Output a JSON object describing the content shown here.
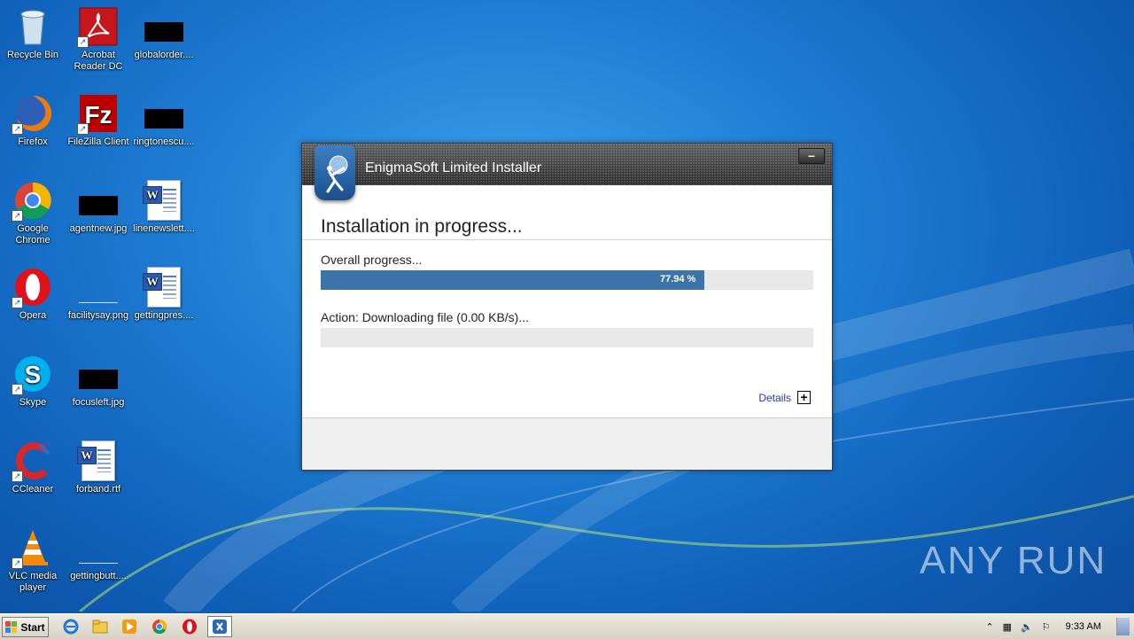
{
  "desktop": {
    "icons": [
      {
        "label": "Recycle Bin",
        "icon": "recycle-bin-icon"
      },
      {
        "label": "Acrobat Reader DC",
        "icon": "acrobat-reader-icon"
      },
      {
        "label": "globalorder....",
        "icon": "redacted-file-icon"
      },
      {
        "label": "Firefox",
        "icon": "firefox-icon"
      },
      {
        "label": "FileZilla Client",
        "icon": "filezilla-icon"
      },
      {
        "label": "ringtonescu....",
        "icon": "redacted-file-icon"
      },
      {
        "label": "Google Chrome",
        "icon": "chrome-icon"
      },
      {
        "label": "agentnew.jpg",
        "icon": "redacted-file-icon"
      },
      {
        "label": "linenewslett....",
        "icon": "word-document-icon"
      },
      {
        "label": "Opera",
        "icon": "opera-icon"
      },
      {
        "label": "facilitysay.png",
        "icon": "image-file-icon"
      },
      {
        "label": "gettingpres....",
        "icon": "word-document-icon"
      },
      {
        "label": "Skype",
        "icon": "skype-icon"
      },
      {
        "label": "focusleft.jpg",
        "icon": "redacted-file-icon"
      },
      {
        "label": "CCleaner",
        "icon": "ccleaner-icon"
      },
      {
        "label": "forband.rtf",
        "icon": "word-document-icon"
      },
      {
        "label": "VLC media player",
        "icon": "vlc-icon"
      },
      {
        "label": "gettingbutt....",
        "icon": "image-file-icon"
      }
    ]
  },
  "installer": {
    "title": "EnigmaSoft Limited Installer",
    "minimize_label": "–",
    "heading": "Installation in progress...",
    "overall_label": "Overall progress...",
    "overall_progress_text": "77.94 %",
    "overall_progress": 77.94,
    "action_label": "Action: Downloading file (0.00 KB/s)...",
    "action_progress": 0,
    "details_label": "Details",
    "details_toggle": "+",
    "colors": {
      "progress_fill": "#3c73a8",
      "titlebar": "#2f2f2f"
    }
  },
  "watermark": "ANY RUN",
  "taskbar": {
    "start_label": "Start",
    "items": [
      "internet-explorer-icon",
      "explorer-folder-icon",
      "media-player-icon",
      "chrome-icon",
      "opera-icon",
      "installer-icon"
    ],
    "tray": {
      "clock": "9:33 AM"
    }
  }
}
